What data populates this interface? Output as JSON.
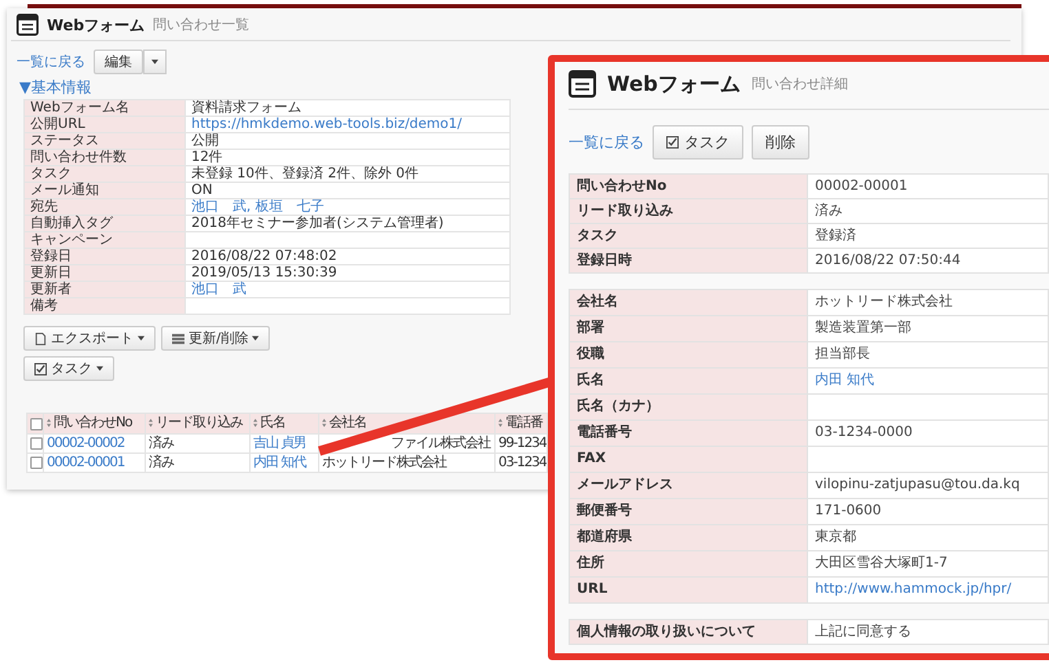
{
  "list_page": {
    "title": "Webフォーム",
    "subtitle": "問い合わせ一覧",
    "back_link": "一覧に戻る",
    "edit_button": "編集",
    "section_heading": "▼基本情報",
    "info": [
      {
        "label": "Webフォーム名",
        "value": "資料請求フォーム",
        "kind": "text"
      },
      {
        "label": "公開URL",
        "value": "https://hmkdemo.web-tools.biz/demo1/",
        "kind": "link"
      },
      {
        "label": "ステータス",
        "value": "公開",
        "kind": "text"
      },
      {
        "label": "問い合わせ件数",
        "value": "12件",
        "kind": "text"
      },
      {
        "label": "タスク",
        "value": "未登録 10件、登録済 2件、除外 0件",
        "kind": "text"
      },
      {
        "label": "メール通知",
        "value": "ON",
        "kind": "text"
      },
      {
        "label": "宛先",
        "value": "池口　武, 板垣　七子",
        "kind": "link"
      },
      {
        "label": "自動挿入タグ",
        "value": "2018年セミナー参加者(システム管理者)",
        "kind": "text"
      },
      {
        "label": "キャンペーン",
        "kind": "text"
      },
      {
        "label": "登録日",
        "value": "2016/08/22 07:48:02",
        "kind": "text"
      },
      {
        "label": "更新日",
        "value": "2019/05/13 15:30:39",
        "kind": "text"
      },
      {
        "label": "更新者",
        "value": "池口　武",
        "kind": "link"
      },
      {
        "label": "備考",
        "kind": "text"
      }
    ],
    "actions": [
      {
        "label": "エクスポート"
      },
      {
        "label": "更新/削除"
      }
    ],
    "task_button": "タスク",
    "table": {
      "select_all_checked": false,
      "columns": [
        "問い合わせNo",
        "リード取り込み",
        "氏名",
        "会社名",
        "電話番"
      ],
      "rows": [
        {
          "checked": false,
          "cells": [
            {
              "text": "00002-00002",
              "kind": "link"
            },
            {
              "text": "済み",
              "kind": "text"
            },
            {
              "text": "吉山 貞男",
              "kind": "link"
            },
            {
              "text": "ファイル株式会社",
              "kind": "covered"
            },
            {
              "text": "99-1234",
              "kind": "text"
            }
          ]
        },
        {
          "checked": false,
          "cells": [
            {
              "text": "00002-00001",
              "kind": "link"
            },
            {
              "text": "済み",
              "kind": "text"
            },
            {
              "text": "内田 知代",
              "kind": "link"
            },
            {
              "text": "ホットリード株式会社",
              "kind": "text"
            },
            {
              "text": "03-1234",
              "kind": "text"
            }
          ]
        }
      ]
    }
  },
  "detail_panel": {
    "title": "Webフォーム",
    "subtitle": "問い合わせ詳細",
    "back_link": "一覧に戻る",
    "buttons": [
      {
        "label": "タスク"
      },
      {
        "label": "削除"
      }
    ],
    "sections": [
      [
        {
          "label": "問い合わせNo",
          "value": "00002-00001",
          "kind": "text"
        },
        {
          "label": "リード取り込み",
          "value": "済み",
          "kind": "text"
        },
        {
          "label": "タスク",
          "value": "登録済",
          "kind": "text"
        },
        {
          "label": "登録日時",
          "value": "2016/08/22 07:50:44",
          "kind": "text"
        }
      ],
      [
        {
          "label": "会社名",
          "value": "ホットリード株式会社",
          "kind": "text"
        },
        {
          "label": "部署",
          "value": "製造装置第一部",
          "kind": "text"
        },
        {
          "label": "役職",
          "value": "担当部長",
          "kind": "text"
        },
        {
          "label": "氏名",
          "value": "内田 知代",
          "kind": "link"
        },
        {
          "label": "氏名（カナ）",
          "kind": "text"
        },
        {
          "label": "電話番号",
          "value": "03-1234-0000",
          "kind": "text"
        },
        {
          "label": "FAX",
          "kind": "text"
        },
        {
          "label": "メールアドレス",
          "value": "vilopinu-zatjupasu@tou.da.kq",
          "kind": "text"
        },
        {
          "label": "郵便番号",
          "value": "171-0600",
          "kind": "text"
        },
        {
          "label": "都道府県",
          "value": "東京都",
          "kind": "text"
        },
        {
          "label": "住所",
          "value": "大田区雪谷大塚町1-7",
          "kind": "text"
        },
        {
          "label": "URL",
          "value": "http://www.hammock.jp/hpr/",
          "kind": "link"
        }
      ],
      [
        {
          "label": "個人情報の取り扱いについて",
          "value": "上記に同意する",
          "kind": "text"
        }
      ]
    ]
  }
}
